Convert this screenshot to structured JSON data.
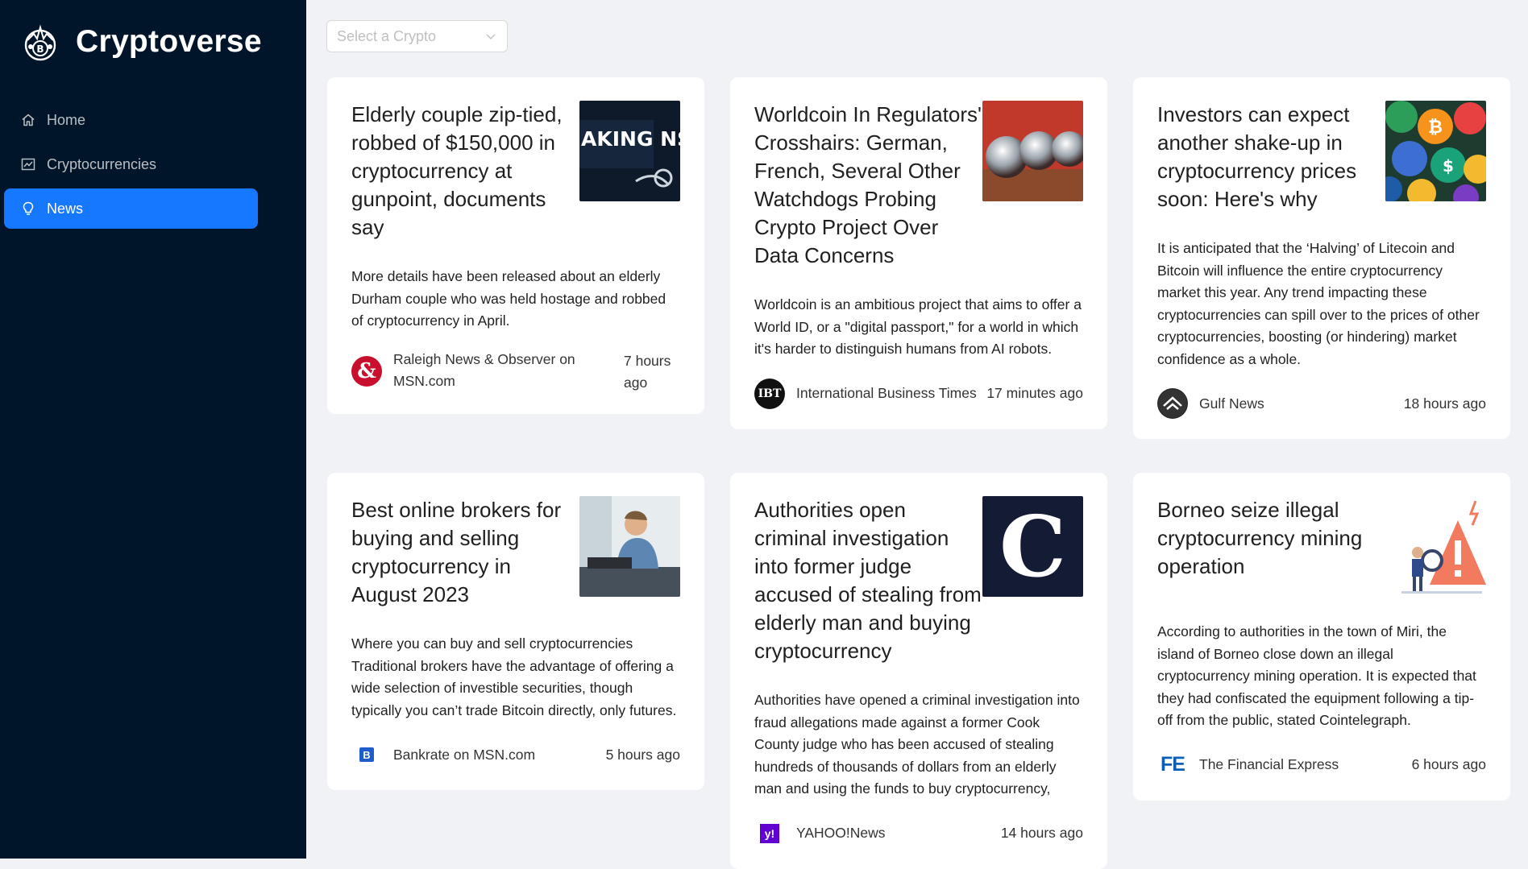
{
  "brand": {
    "title": "Cryptoverse",
    "logo_icon": "crypto-coin-logo-icon"
  },
  "sidebar": {
    "items": [
      {
        "label": "Home",
        "icon": "home-icon"
      },
      {
        "label": "Cryptocurrencies",
        "icon": "fund-icon"
      },
      {
        "label": "News",
        "icon": "bulb-icon",
        "active": true
      }
    ]
  },
  "filter": {
    "placeholder": "Select a Crypto"
  },
  "news": [
    {
      "title": "Elderly couple zip-tied, robbed of $150,000 in cryptocurrency at gunpoint, documents say",
      "description": "More details have been released about an elderly Durham couple who was held hostage and robbed of cryptocurrency in April.",
      "provider": "Raleigh News & Observer on MSN.com",
      "time": "7 hours ago",
      "thumb_text": "AKING NS"
    },
    {
      "title": "Worldcoin In Regulators' Crosshairs: German, French, Several Other Watchdogs Probing Crypto Project Over Data Concerns",
      "description": "Worldcoin is an ambitious project that aims to offer a World ID, or a \"digital passport,\" for a world in which it's harder to distinguish humans from AI robots.",
      "provider": "International Business Times",
      "time": "17 minutes ago",
      "prov_text": "IBT"
    },
    {
      "title": "Investors can expect another shake-up in cryptocurrency prices soon: Here's why",
      "description": "It is anticipated that the ‘Halving’ of Litecoin and Bitcoin will influence the entire cryptocurrency market this year. Any trend impacting these cryptocurrencies can spill over to the prices of other cryptocurrencies, boosting (or hindering) market confidence as a whole.",
      "provider": "Gulf News",
      "time": "18 hours ago"
    },
    {
      "title": "Best online brokers for buying and selling cryptocurrency in August 2023",
      "description": "Where you can buy and sell cryptocurrencies Traditional brokers have the advantage of offering a wide selection of investible securities, though typically you can’t trade Bitcoin directly, only futures.",
      "provider": "Bankrate on MSN.com",
      "time": "5 hours ago",
      "prov_text": "B"
    },
    {
      "title": "Authorities open criminal investigation into former judge accused of stealing from elderly man and buying cryptocurrency",
      "description": "Authorities have opened a criminal investigation into fraud allegations made against a former Cook County judge who has been accused of stealing hundreds of thousands of dollars from an elderly man and using the funds to buy cryptocurrency,",
      "provider": "YAHOO!News",
      "time": "14 hours ago",
      "prov_text": "y!",
      "thumb_text": "C"
    },
    {
      "title": "Borneo seize illegal cryptocurrency mining operation",
      "description": "According to authorities in the town of Miri, the island of Borneo close down an illegal cryptocurrency mining operation. It is expected that they had confiscated the equipment following a tip-off from the public, stated Cointelegraph.",
      "provider": "The Financial Express",
      "time": "6 hours ago",
      "prov_text": "FE"
    }
  ],
  "colors": {
    "sidebar_bg": "#001529",
    "accent": "#1677ff",
    "page_bg": "#f0f2f5"
  }
}
